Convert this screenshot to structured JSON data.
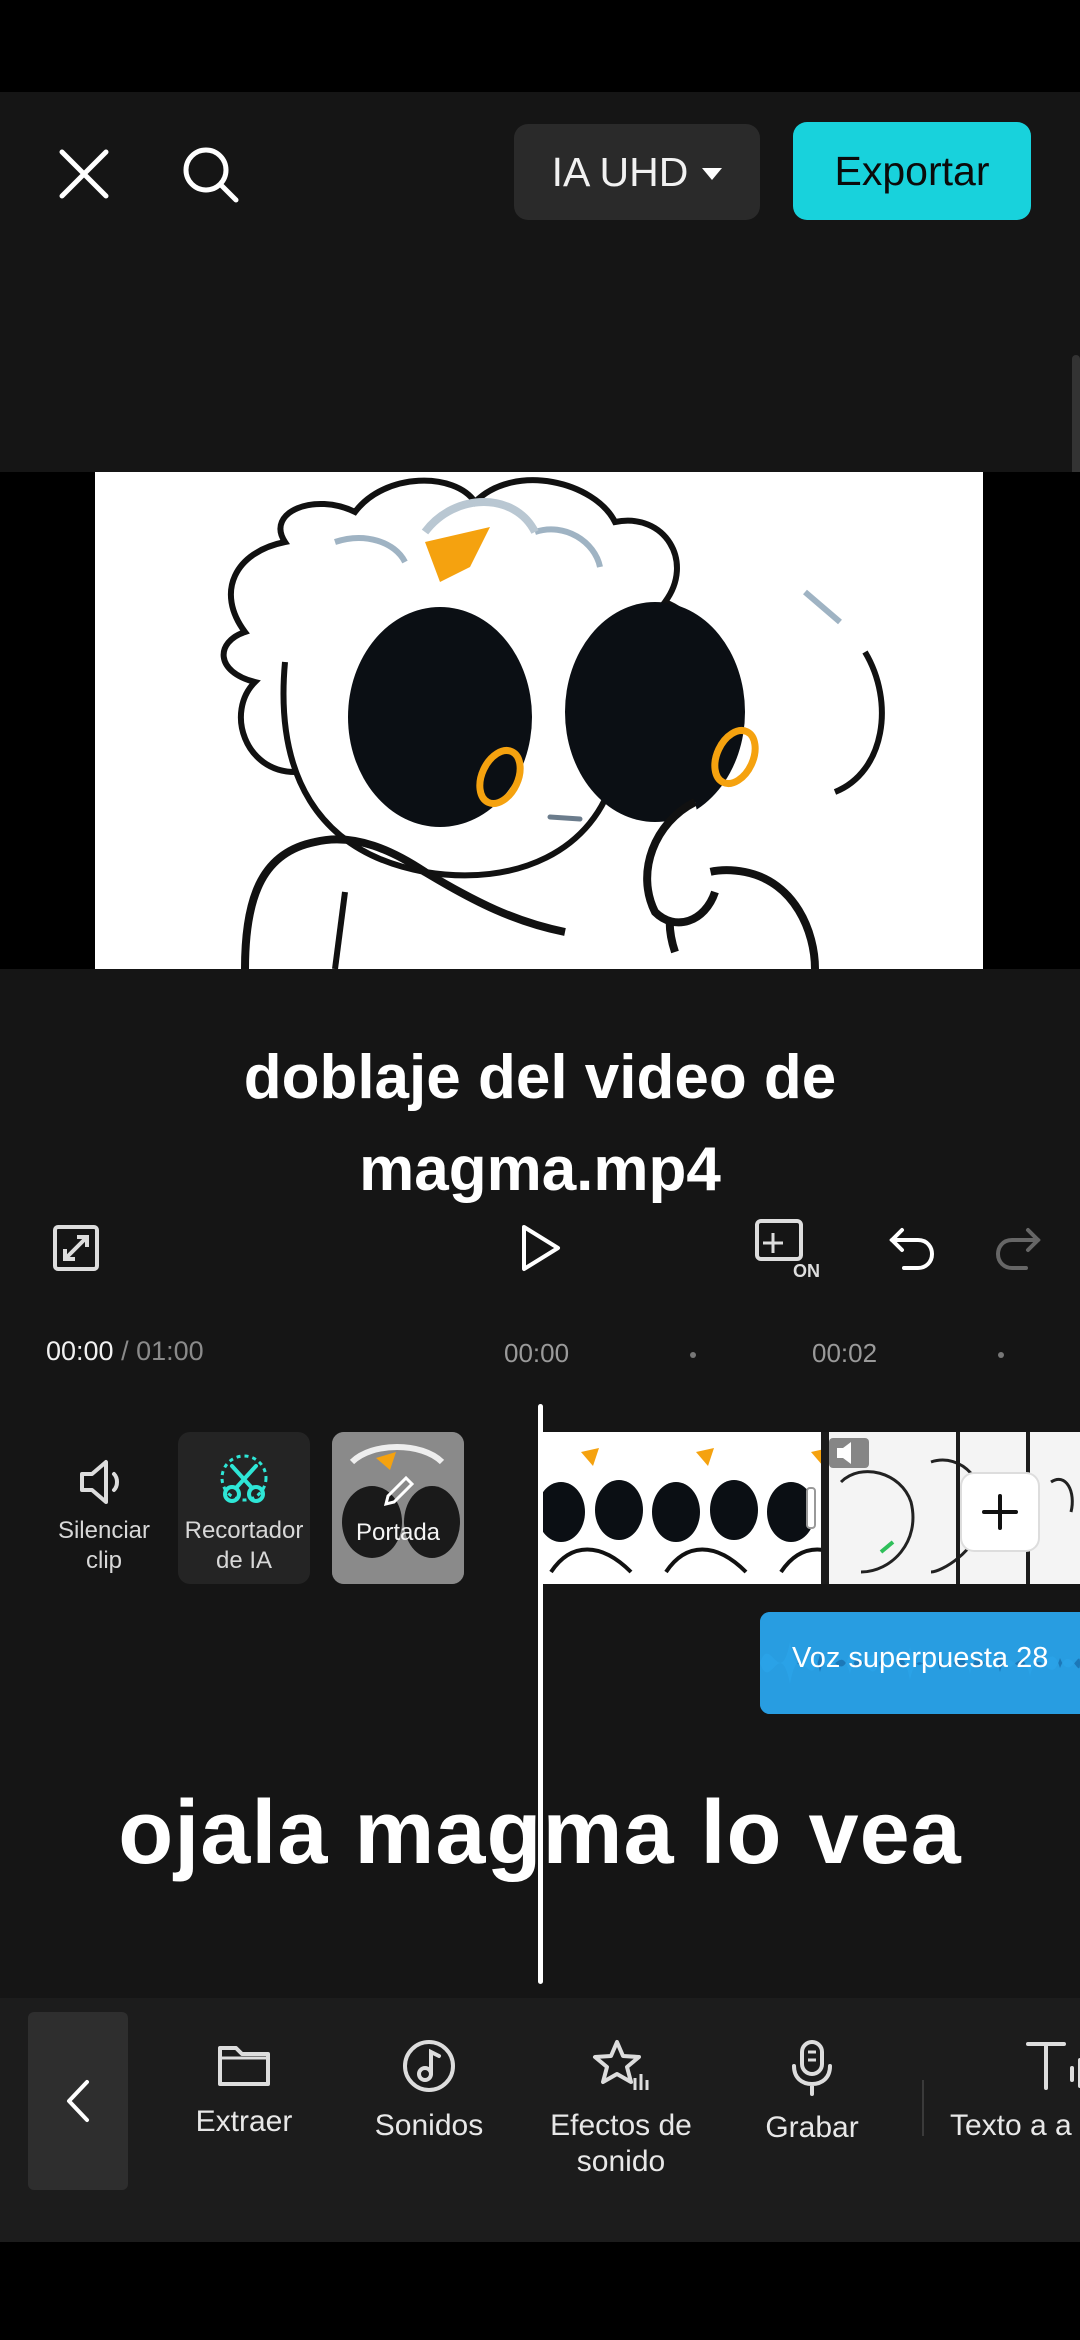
{
  "header": {
    "quality_label": "IA UHD",
    "export_label": "Exportar"
  },
  "preview": {
    "caption_line1": "doblaje del video de",
    "caption_line2": "magma.mp4",
    "colors": {
      "accent": "#18d2dc",
      "eye_orange": "#f5a20f"
    }
  },
  "controls": {
    "overlay_toggle_text": "ON"
  },
  "timeline": {
    "current_time": "00:00",
    "total_time": "/ 01:00",
    "ruler": [
      "00:00",
      "00:02"
    ],
    "clip_tools": [
      {
        "label": "Silenciar clip"
      },
      {
        "label": "Recortador de IA"
      },
      {
        "label": "Portada"
      }
    ],
    "voice_track_label": "Voz superpuesta 28",
    "overlay_text": "ojala magma lo vea"
  },
  "toolbar": {
    "items": [
      {
        "label": "Extraer",
        "icon": "folder-icon"
      },
      {
        "label": "Sonidos",
        "icon": "music-note-icon"
      },
      {
        "label": "Efectos de sonido",
        "icon": "sound-effects-icon"
      },
      {
        "label": "Grabar",
        "icon": "microphone-icon"
      },
      {
        "label": "Texto a a",
        "icon": "text-to-audio-icon"
      }
    ]
  }
}
